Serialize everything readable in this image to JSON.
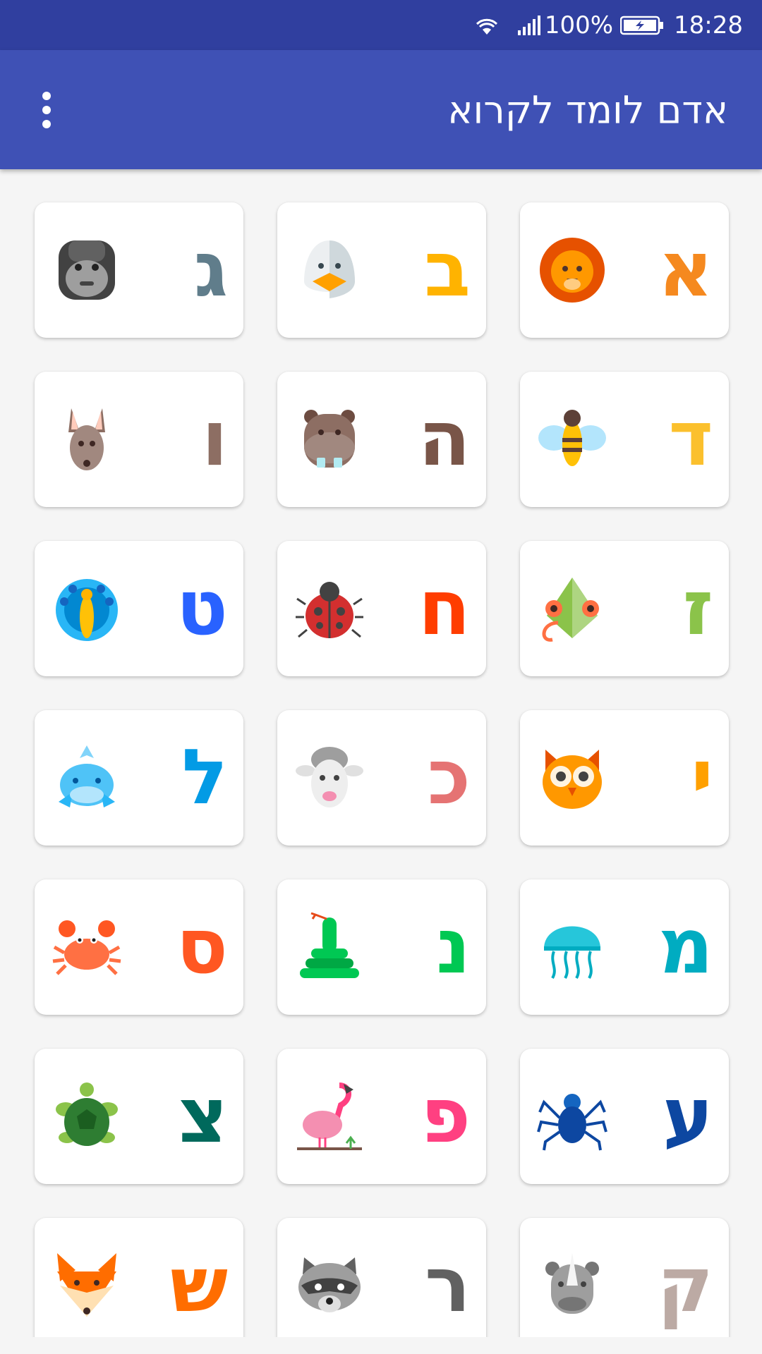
{
  "status_bar": {
    "battery": "100%",
    "time": "18:28",
    "icons": [
      "wifi-icon",
      "signal-icon",
      "battery-charging-icon"
    ]
  },
  "app_bar": {
    "title": "אדם לומד לקרוא",
    "overflow_icon": "more-vertical-icon",
    "color": "#3f51b5"
  },
  "cards": [
    {
      "letter": "א",
      "color": "#f5891f",
      "animal": "lion-icon"
    },
    {
      "letter": "ב",
      "color": "#ffb300",
      "animal": "duck-icon"
    },
    {
      "letter": "ג",
      "color": "#607d8b",
      "animal": "gorilla-icon"
    },
    {
      "letter": "ד",
      "color": "#fbc02d",
      "animal": "bee-icon"
    },
    {
      "letter": "ה",
      "color": "#795548",
      "animal": "hippo-icon"
    },
    {
      "letter": "ו",
      "color": "#8d6e63",
      "animal": "kangaroo-icon"
    },
    {
      "letter": "ז",
      "color": "#8bc34a",
      "animal": "chameleon-icon"
    },
    {
      "letter": "ח",
      "color": "#ff3d00",
      "animal": "ladybug-icon"
    },
    {
      "letter": "ט",
      "color": "#2962ff",
      "animal": "peacock-icon"
    },
    {
      "letter": "י",
      "color": "#ffa000",
      "animal": "owl-icon"
    },
    {
      "letter": "כ",
      "color": "#e57373",
      "animal": "sheep-icon"
    },
    {
      "letter": "ל",
      "color": "#039be5",
      "animal": "whale-icon"
    },
    {
      "letter": "מ",
      "color": "#00acc1",
      "animal": "jellyfish-icon"
    },
    {
      "letter": "נ",
      "color": "#00c853",
      "animal": "snake-icon"
    },
    {
      "letter": "ס",
      "color": "#ff5722",
      "animal": "crab-icon"
    },
    {
      "letter": "ע",
      "color": "#0d47a1",
      "animal": "spider-icon"
    },
    {
      "letter": "פ",
      "color": "#ff4081",
      "animal": "flamingo-icon"
    },
    {
      "letter": "צ",
      "color": "#00695c",
      "animal": "turtle-icon"
    },
    {
      "letter": "ק",
      "color": "#bcaaa4",
      "animal": "rhino-icon"
    },
    {
      "letter": "ר",
      "color": "#616161",
      "animal": "raccoon-icon"
    },
    {
      "letter": "ש",
      "color": "#ff6d00",
      "animal": "fox-icon"
    }
  ]
}
